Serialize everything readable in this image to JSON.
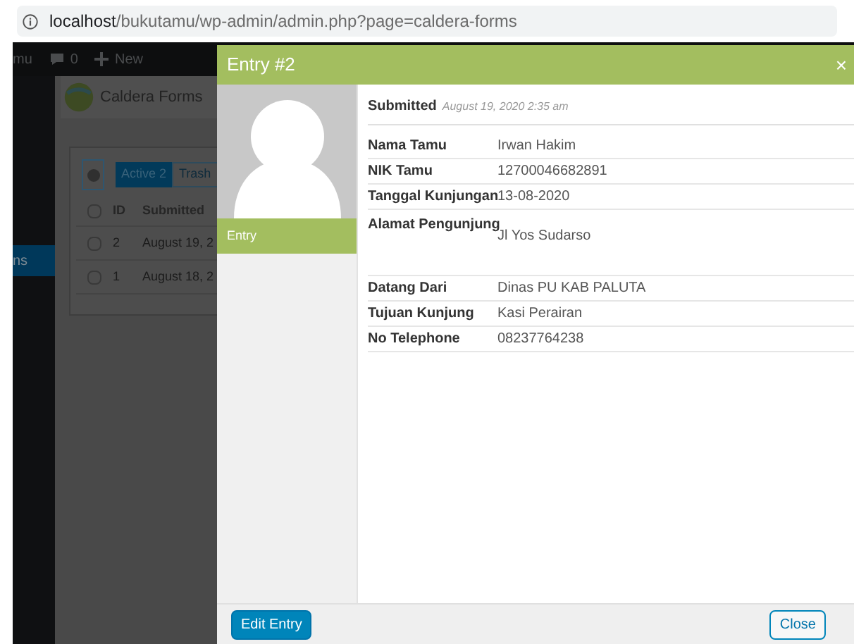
{
  "browser": {
    "url_host": "localhost",
    "url_path": "/bukutamu/wp-admin/admin.php?page=caldera-forms"
  },
  "admin_bar": {
    "site": "mu",
    "comments": "0",
    "new": "New"
  },
  "sidebar": {
    "items": [
      {
        "label": "ns",
        "selected": true
      }
    ]
  },
  "plugin": {
    "title": "Caldera Forms",
    "tabs": [
      {
        "label": "Active 2",
        "selected": true
      },
      {
        "label": "Trash",
        "selected": false
      }
    ],
    "columns": [
      "ID",
      "Submitted"
    ],
    "select_all_checked": false,
    "rows": [
      {
        "id": "2",
        "submitted": "August 19, 2",
        "checked": false
      },
      {
        "id": "1",
        "submitted": "August 18, 2",
        "checked": false
      }
    ]
  },
  "modal": {
    "title": "Entry #2",
    "close": "×",
    "sidebar_tab": "Entry",
    "submitted_label": "Submitted",
    "submitted_at": "August 19, 2020 2:35 am",
    "fields": [
      {
        "label": "Nama Tamu",
        "value": "Irwan Hakim",
        "kind": "line"
      },
      {
        "label": "NIK Tamu",
        "value": "12700046682891",
        "kind": "line"
      },
      {
        "label": "Tanggal Kunjungan",
        "value": "13-08-2020",
        "kind": "line"
      },
      {
        "label": "Alamat Pengunjung",
        "value": "Jl Yos Sudarso",
        "kind": "paragraph"
      },
      {
        "label": "Datang Dari",
        "value": "Dinas PU KAB PALUTA",
        "kind": "line"
      },
      {
        "label": "Tujuan Kunjung",
        "value": "Kasi Perairan",
        "kind": "line"
      },
      {
        "label": "No Telephone",
        "value": "08237764238",
        "kind": "line"
      }
    ],
    "buttons": [
      {
        "label": "Edit Entry",
        "kind": "primary"
      },
      {
        "label": "Close",
        "kind": "secondary"
      }
    ]
  }
}
